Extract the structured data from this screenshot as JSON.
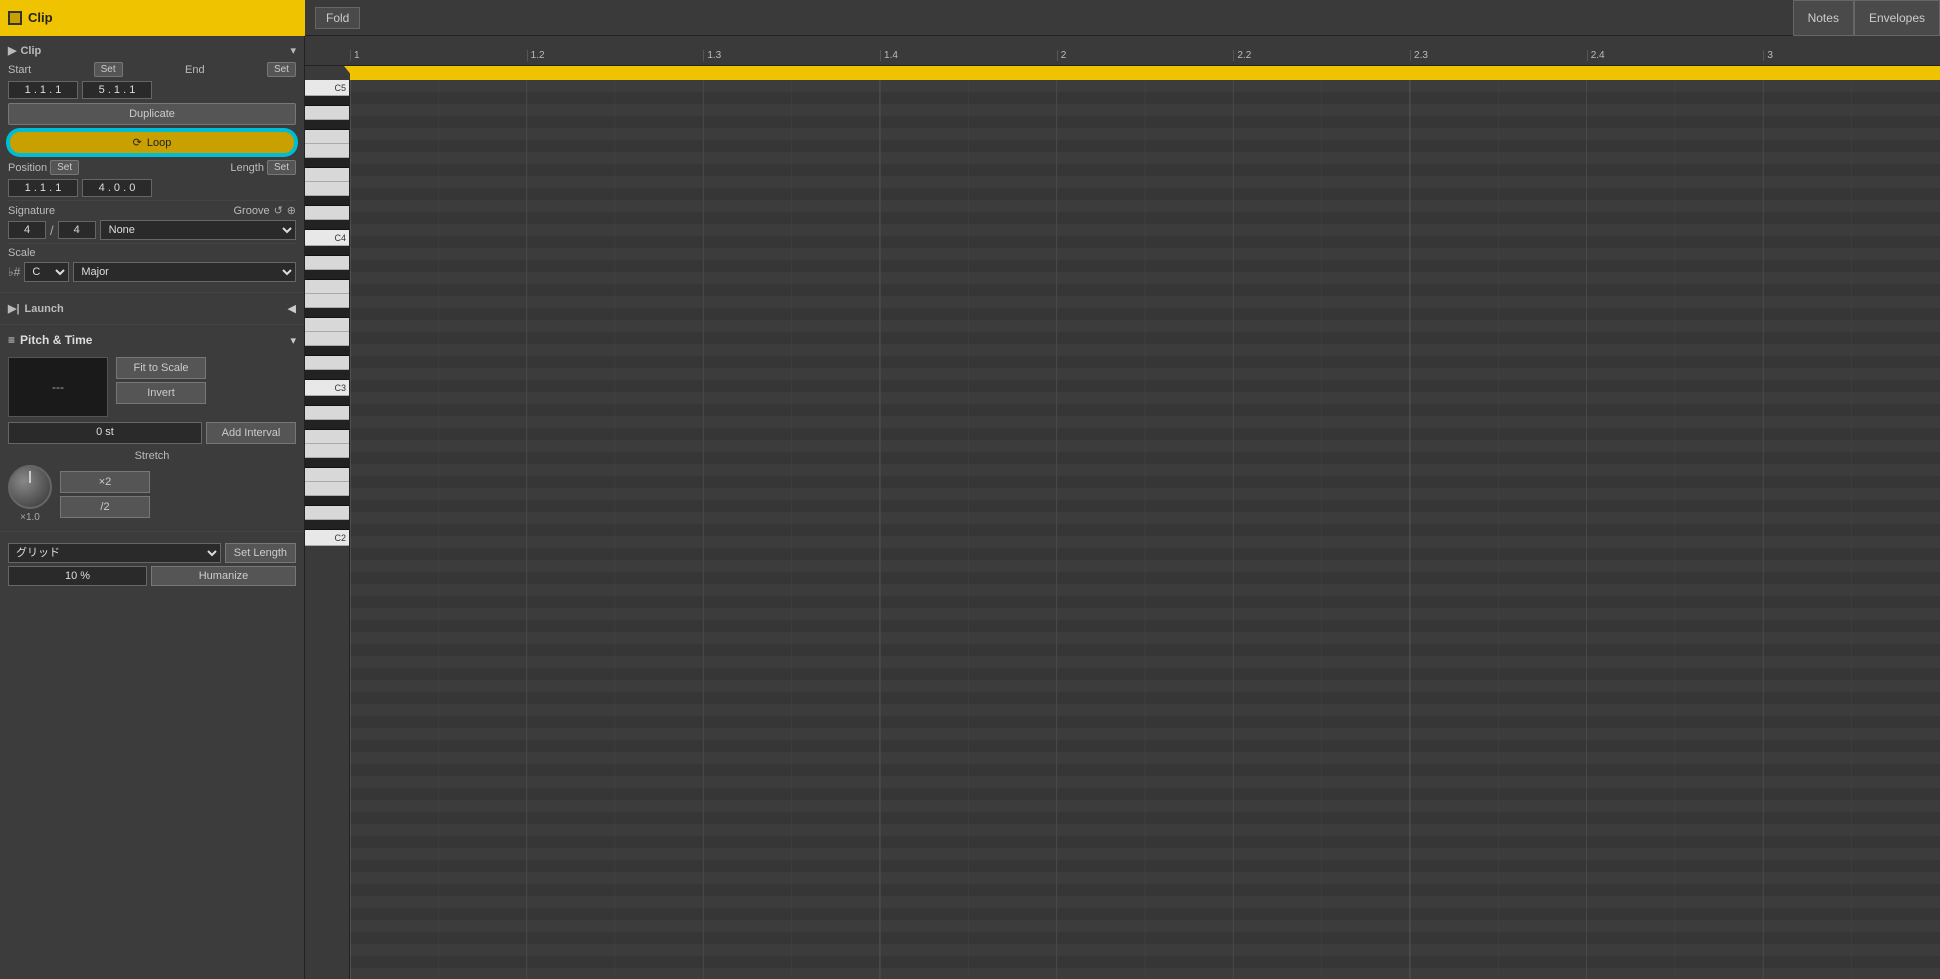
{
  "header": {
    "clip_icon": "■",
    "clip_title": "Clip",
    "fold_label": "Fold",
    "notes_label": "Notes",
    "envelopes_label": "Envelopes"
  },
  "left_panel": {
    "clip_section_title": "Clip",
    "start_label": "Start",
    "set_label": "Set",
    "end_label": "End",
    "set2_label": "Set",
    "start_value": "1 . 1 . 1",
    "end_value": "5 . 1 . 1",
    "duplicate_label": "Duplicate",
    "loop_icon": "⟳",
    "loop_label": "Loop",
    "position_label": "Position",
    "position_set": "Set",
    "length_label": "Length",
    "length_set": "Set",
    "position_value": "1 . 1 . 1",
    "length_value": "4 . 0 . 0",
    "signature_label": "Signature",
    "groove_label": "Groove",
    "sig_num": "4",
    "sig_den": "4",
    "groove_value": "None",
    "scale_label": "Scale",
    "scale_icon": "♭#",
    "scale_root": "C",
    "scale_type": "Major",
    "launch_label": "Launch",
    "pitch_time_label": "Pitch & Time",
    "pitch_display": "---",
    "fit_to_scale_label": "Fit to Scale",
    "invert_label": "Invert",
    "semitone_label": "0 st",
    "add_interval_label": "Add Interval",
    "stretch_label": "Stretch",
    "knob_value": "×1.0",
    "x2_label": "×2",
    "div2_label": "/2",
    "grid_value": "グリッド",
    "set_length_label": "Set Length",
    "percent_value": "10 %",
    "humanize_label": "Humanize"
  },
  "timeline": {
    "markers": [
      "1",
      "1.2",
      "1.3",
      "1.4",
      "2",
      "2.2",
      "2.3",
      "2.4",
      "3"
    ]
  },
  "piano_keys": {
    "labels": [
      "C5",
      "C4",
      "C3",
      "C2"
    ]
  },
  "colors": {
    "accent_yellow": "#f0c300",
    "accent_cyan": "#00bcd4",
    "bg_dark": "#2a2a2a",
    "bg_panel": "#3c3c3c",
    "grid_dark": "#363636",
    "grid_light": "#3e3e3e"
  }
}
